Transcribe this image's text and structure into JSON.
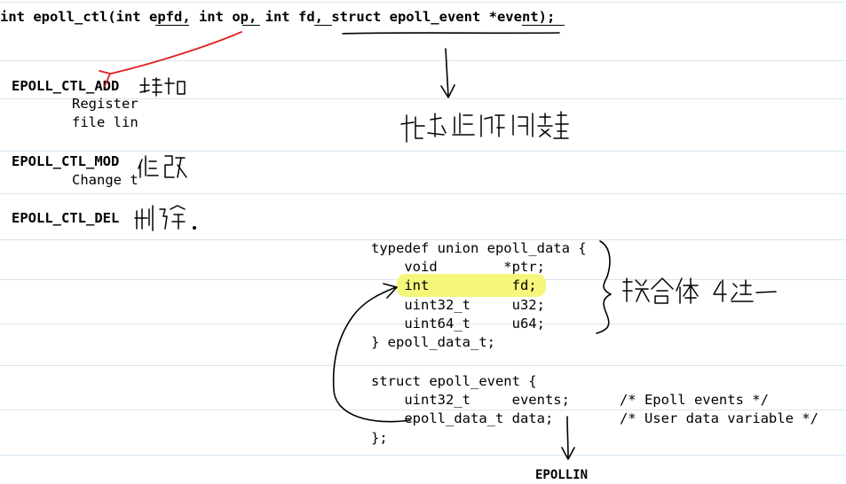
{
  "signature": {
    "prefix": "int epoll_ctl(int ",
    "arg_epfd": "epfd",
    "sep1": ", int ",
    "arg_op": "op",
    "sep2": ", int ",
    "arg_fd": "fd",
    "sep3": ", struct epoll_event *",
    "arg_event": "event",
    "suffix": ");"
  },
  "ops": [
    {
      "name": "EPOLL_CTL_ADD",
      "lines": [
        "Register",
        "file lin"
      ]
    },
    {
      "name": "EPOLL_CTL_MOD",
      "lines": [
        "Change t"
      ]
    },
    {
      "name": "EPOLL_CTL_DEL",
      "lines": []
    }
  ],
  "code": {
    "union_lines": [
      "typedef union epoll_data {",
      "    void        *ptr;",
      "    int          fd;",
      "    uint32_t     u32;",
      "    uint64_t     u64;",
      "} epoll_data_t;"
    ],
    "struct_lines": [
      "struct epoll_event {",
      "    uint32_t     events;      /* Epoll events */",
      "    epoll_data_t data;        /* User data variable */",
      "};"
    ]
  },
  "bottom_label": "EPOLLIN",
  "colors": {
    "highlight": "#f4f77a",
    "red_ink": "#e02020",
    "rule": "#d6e6f2"
  }
}
